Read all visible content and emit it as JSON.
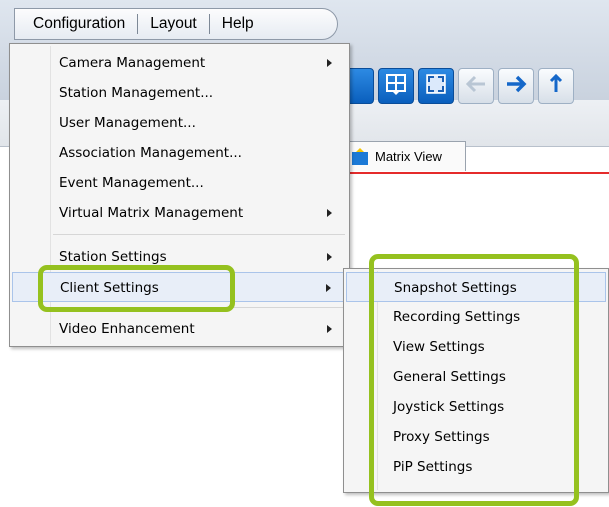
{
  "menubar": {
    "items": [
      {
        "label": "Configuration"
      },
      {
        "label": "Layout"
      },
      {
        "label": "Help"
      }
    ]
  },
  "tab": {
    "label": "Matrix View"
  },
  "dropdown": {
    "items": [
      {
        "label": "Camera Management",
        "submenu": true
      },
      {
        "label": "Station Management...",
        "submenu": false
      },
      {
        "label": "User Management...",
        "submenu": false
      },
      {
        "label": "Association Management...",
        "submenu": false
      },
      {
        "label": "Event Management...",
        "submenu": false
      },
      {
        "label": "Virtual Matrix Management",
        "submenu": true
      },
      {
        "label": "Station Settings",
        "submenu": true
      },
      {
        "label": "Client Settings",
        "submenu": true
      },
      {
        "label": "Video Enhancement",
        "submenu": true
      }
    ]
  },
  "submenu": {
    "items": [
      {
        "label": "Snapshot Settings"
      },
      {
        "label": "Recording Settings"
      },
      {
        "label": "View Settings"
      },
      {
        "label": "General Settings"
      },
      {
        "label": "Joystick Settings"
      },
      {
        "label": "Proxy Settings"
      },
      {
        "label": "PiP Settings"
      }
    ]
  },
  "colors": {
    "annotation_green": "#95c11f",
    "toolbar_blue": "#0a5fbd",
    "red_line": "#e52b2b"
  },
  "icons": [
    "matrix-view-icon",
    "layout-grid-icon",
    "fullscreen-icon",
    "back-arrow-icon",
    "forward-arrow-icon",
    "submenu-arrow-icon"
  ]
}
